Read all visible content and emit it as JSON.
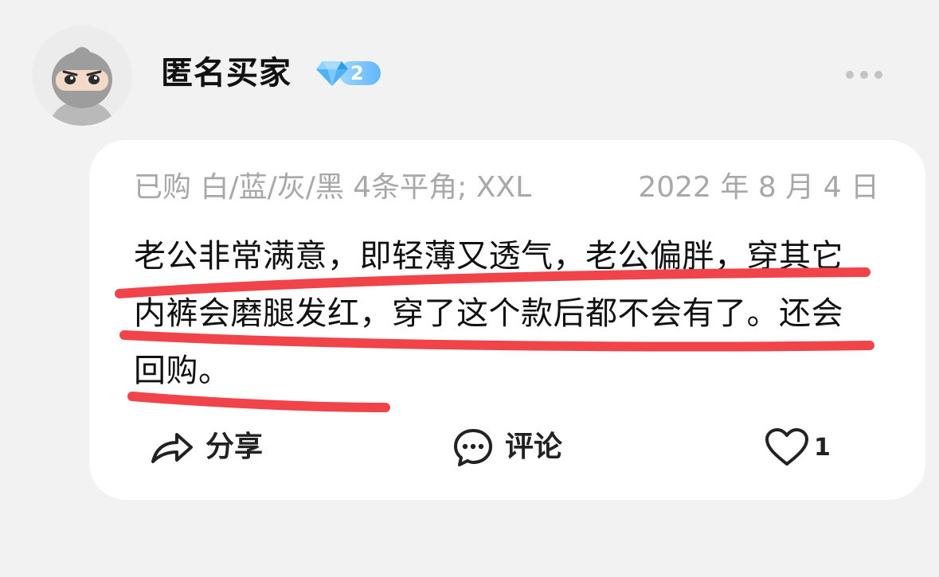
{
  "user": {
    "name": "匿名买家",
    "level": "2",
    "avatar": "ninja-avatar-icon"
  },
  "header": {
    "more_icon": "more-dots-icon"
  },
  "review": {
    "purchase_info": "已购 白/蓝/灰/黑 4条平角; XXL",
    "date": "2022 年 8 月 4 日",
    "text": "老公非常满意，即轻薄又透气，老公偏胖，穿其它内裤会磨腿发红，穿了这个款后都不会有了。还会回购。",
    "highlight_color": "#f0444a"
  },
  "actions": {
    "share_label": "分享",
    "comment_label": "评论",
    "like_count": "1",
    "share_icon": "share-arrow-icon",
    "comment_icon": "comment-bubble-icon",
    "like_icon": "heart-icon"
  },
  "colors": {
    "background": "#f2f2f2",
    "card": "#ffffff",
    "muted_text": "#a8a8a8",
    "badge_blue": "#4fb2f7"
  }
}
